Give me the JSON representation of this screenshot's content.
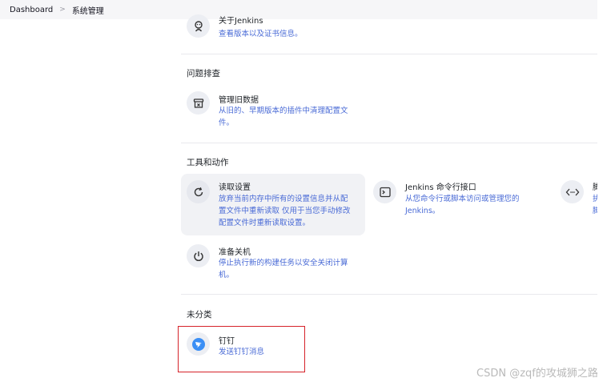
{
  "breadcrumb": {
    "items": [
      "Dashboard",
      "系统管理"
    ],
    "separator": ">"
  },
  "sections": {
    "about": {
      "title": "关于Jenkins",
      "desc": [
        "查看版本以及证书信息。"
      ]
    },
    "troubleshooting": {
      "heading": "问题排查",
      "items": [
        {
          "title": "管理旧数据",
          "desc": [
            "从旧的、早期版本的插件中清理配置文",
            "件。"
          ]
        }
      ]
    },
    "tools": {
      "heading": "工具和动作",
      "items": [
        {
          "title": "读取设置",
          "desc": [
            "放弃当前内存中所有的设置信息并从配",
            "置文件中重新读取 仅用于当您手动修改",
            "配置文件时重新读取设置。"
          ]
        },
        {
          "title": "Jenkins 命令行接口",
          "desc": [
            "从您命令行或脚本访问或管理您的",
            "Jenkins。"
          ]
        },
        {
          "title": "脚",
          "desc": [
            "执",
            "脚"
          ]
        },
        {
          "title": "准备关机",
          "desc": [
            "停止执行新的构建任务以安全关闭计算",
            "机。"
          ]
        }
      ]
    },
    "uncategorized": {
      "heading": "未分类",
      "items": [
        {
          "title": "钉钉",
          "desc": [
            "发送钉钉消息"
          ]
        }
      ]
    }
  },
  "watermark": "CSDN @zqf的攻城狮之路",
  "colors": {
    "accent_link": "#4a6bd6",
    "highlight_box": "#d6232a",
    "dingtalk_blue": "#3b8ff5"
  }
}
